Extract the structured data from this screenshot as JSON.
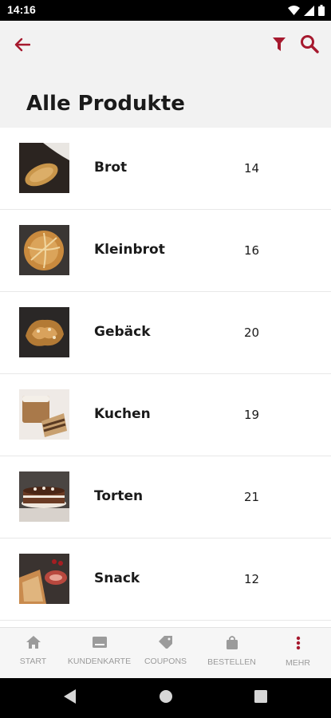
{
  "status_bar": {
    "time": "14:16"
  },
  "header": {
    "title": "Alle Produkte"
  },
  "colors": {
    "accent": "#a6192e",
    "header_bg": "#f2f2f2",
    "nav_inactive": "#9b9b9b"
  },
  "products": [
    {
      "name": "Brot",
      "count": "14",
      "image": "brot-image"
    },
    {
      "name": "Kleinbrot",
      "count": "16",
      "image": "kleinbrot-image"
    },
    {
      "name": "Gebäck",
      "count": "20",
      "image": "gebaeck-image"
    },
    {
      "name": "Kuchen",
      "count": "19",
      "image": "kuchen-image"
    },
    {
      "name": "Torten",
      "count": "21",
      "image": "torten-image"
    },
    {
      "name": "Snack",
      "count": "12",
      "image": "snack-image"
    }
  ],
  "bottom_nav": {
    "start": "START",
    "kundenkarte": "KUNDENKARTE",
    "coupons": "COUPONS",
    "bestellen": "BESTELLEN",
    "mehr": "MEHR"
  }
}
